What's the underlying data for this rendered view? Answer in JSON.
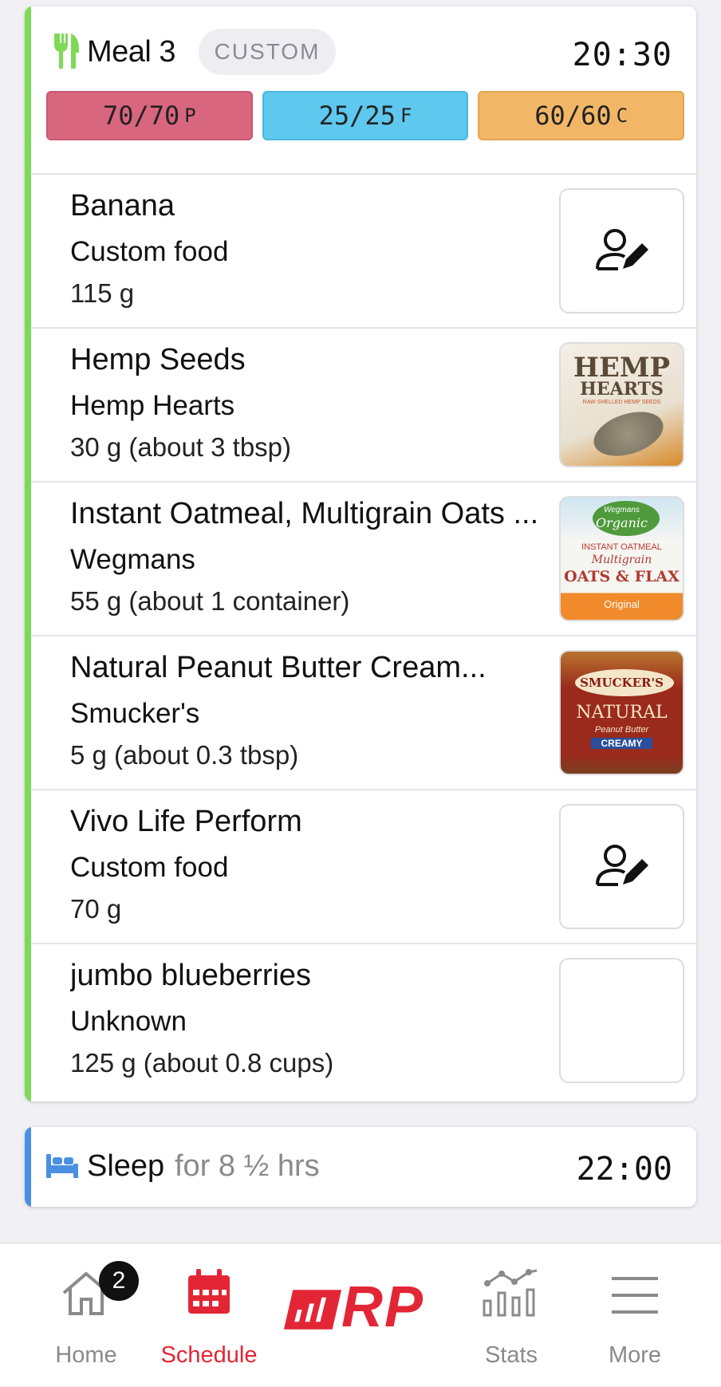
{
  "colors": {
    "meal_accent": "#7ed957",
    "sleep_accent": "#4a90e2",
    "protein": "#d9667f",
    "fat": "#5ec8ef",
    "carbs": "#f2b766",
    "brand_red": "#e32636"
  },
  "meal": {
    "title": "Meal 3",
    "chip": "CUSTOM",
    "time": "20:30",
    "icon": "fork-knife-icon",
    "macros": [
      {
        "value": "70/70",
        "unit": "P"
      },
      {
        "value": "25/25",
        "unit": "F"
      },
      {
        "value": "60/60",
        "unit": "C"
      }
    ],
    "foods": [
      {
        "name": "Banana",
        "brand": "Custom food",
        "amount": "115 g",
        "thumb": "custom-food-icon"
      },
      {
        "name": "Hemp Seeds",
        "brand": "Hemp Hearts",
        "amount": "30 g (about 3 tbsp)",
        "thumb": "product-image",
        "thumb_text": [
          "HEMP",
          "HEARTS",
          "RAW SHELLED HEMP SEEDS"
        ]
      },
      {
        "name": "Instant Oatmeal, Multigrain Oats ...",
        "brand": "Wegmans",
        "amount": "55 g (about 1 container)",
        "thumb": "product-image",
        "thumb_text": [
          "Wegmans",
          "Organic",
          "INSTANT OATMEAL",
          "Multigrain",
          "OATS & FLAX",
          "Original"
        ]
      },
      {
        "name": "Natural Peanut Butter Cream...",
        "brand": "Smucker's",
        "amount": "5 g (about 0.3 tbsp)",
        "thumb": "product-image",
        "thumb_text": [
          "SMUCKER'S",
          "NATURAL",
          "Peanut Butter",
          "CREAMY"
        ]
      },
      {
        "name": "Vivo Life Perform",
        "brand": "Custom food",
        "amount": "70 g",
        "thumb": "custom-food-icon"
      },
      {
        "name": "jumbo blueberries",
        "brand": "Unknown",
        "amount": "125 g (about 0.8 cups)",
        "thumb": "empty"
      }
    ]
  },
  "sleep": {
    "label": "Sleep",
    "duration": "for 8 ½ hrs",
    "time": "22:00",
    "icon": "bed-icon"
  },
  "tabbar": {
    "home": {
      "label": "Home",
      "badge": "2",
      "icon": "home-icon"
    },
    "schedule": {
      "label": "Schedule",
      "icon": "calendar-icon"
    },
    "logo": {
      "text": "RP",
      "icon": "rp-logo"
    },
    "stats": {
      "label": "Stats",
      "icon": "stats-icon"
    },
    "more": {
      "label": "More",
      "icon": "menu-icon"
    }
  }
}
